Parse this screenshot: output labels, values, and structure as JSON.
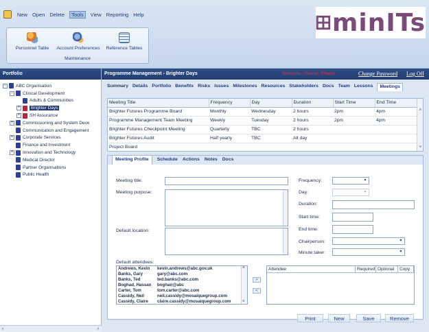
{
  "menu": [
    "New",
    "Open",
    "Delete",
    "Tools",
    "View",
    "Reporting",
    "Help"
  ],
  "menu_active": "Tools",
  "ribbon": {
    "buttons": [
      "Personnel Table",
      "Account Preferences",
      "Reference Tables"
    ],
    "caption": "Maintenance"
  },
  "logo": "minITs",
  "sidebar": {
    "title": "Portfolio",
    "tree": [
      {
        "label": "ABC Organisation",
        "level": 0,
        "exp": "−",
        "color": "navy"
      },
      {
        "label": "Clinical Development",
        "level": 1,
        "exp": "−",
        "color": "navy"
      },
      {
        "label": "Adults & Communities",
        "level": 2,
        "exp": "",
        "color": "navy"
      },
      {
        "label": "Brighter Days",
        "level": 2,
        "exp": "+",
        "color": "red",
        "selected": true
      },
      {
        "label": "SH Assurance",
        "level": 2,
        "exp": "+",
        "color": "red"
      },
      {
        "label": "Commissioning and System Deve",
        "level": 1,
        "exp": "+",
        "color": "navy"
      },
      {
        "label": "Communication and Engagement",
        "level": 1,
        "exp": "",
        "color": "navy"
      },
      {
        "label": "Corporate Services",
        "level": 1,
        "exp": "+",
        "color": "navy"
      },
      {
        "label": "Finance and Investment",
        "level": 1,
        "exp": "",
        "color": "navy"
      },
      {
        "label": "Innovation and Technology",
        "level": 1,
        "exp": "+",
        "color": "navy"
      },
      {
        "label": "Medical Director",
        "level": 1,
        "exp": "",
        "color": "navy"
      },
      {
        "label": "Partner Organisations",
        "level": 1,
        "exp": "",
        "color": "navy"
      },
      {
        "label": "Public Health",
        "level": 1,
        "exp": "",
        "color": "navy"
      }
    ]
  },
  "header": {
    "title": "Programme Management - Brighter Days",
    "welcome": "Welcome, UName, FName",
    "change_password": "Change Password",
    "log_off": "Log Off"
  },
  "tabs": [
    "Summary",
    "Details",
    "Portfolio",
    "Benefits",
    "Risks",
    "Issues",
    "Milestones",
    "Resources",
    "Stakeholders",
    "Docs",
    "Team",
    "Lessons",
    "Meetings"
  ],
  "tab_active": "Meetings",
  "meetings_table": {
    "columns": [
      "Meeting Title",
      "Frequency",
      "Day",
      "Duration",
      "Start Time",
      "End Time"
    ],
    "rows": [
      [
        "Brighter Futures Programme Board",
        "Monthly",
        "Wednesday",
        "2 hours",
        "2pm",
        "4pm"
      ],
      [
        "Programme Management Team Meeting",
        "Weekly",
        "Tuesday",
        "2 hours",
        "2pm",
        "4pm"
      ],
      [
        "Brighter Futures Checkpoint Meeting",
        "Quarterly",
        "TBC",
        "2 hours",
        "",
        ""
      ],
      [
        "Brighter Futures Audit",
        "Half yearly",
        "TBC",
        "All day",
        "",
        ""
      ],
      [
        "Project Board",
        "",
        "",
        "",
        "",
        ""
      ]
    ]
  },
  "subtabs": [
    "Meeting Profile",
    "Schedule",
    "Actions",
    "Notes",
    "Docs"
  ],
  "subtab_active": "Meeting Profile",
  "form": {
    "meeting_title": "Meeting title:",
    "meeting_purpose": "Meeting purpose:",
    "default_location": "Default location:",
    "frequency": "Frequency:",
    "day": "Day:",
    "duration": "Duration:",
    "start_time": "Start time:",
    "end_time": "End time:",
    "chairperson": "Chairperson:",
    "minute_taker": "Minute taker:",
    "default_attendees": "Default attendees:"
  },
  "attendees": [
    [
      "Andrews, Kevin",
      "kevin.andrews@abc.gov.uk"
    ],
    [
      "Banks, Gary",
      "gary@abc.com"
    ],
    [
      "Banks, Ted",
      "ted.banks@abc.com"
    ],
    [
      "Boghad, Hassan",
      "boghan@abc"
    ],
    [
      "Carter, Tom",
      "tom.carter@abc.com"
    ],
    [
      "Cassidy, Neil",
      "neil.cassidy@mosaiquegroup.com"
    ],
    [
      "Cassidy, Claire",
      "claire.cassidy@mosaiquegroup.com"
    ]
  ],
  "attendee_grid_columns": [
    "Attendee",
    "Required",
    "Optional",
    "Copy"
  ],
  "buttons": [
    "Print",
    "New",
    "Save",
    "Remove"
  ]
}
